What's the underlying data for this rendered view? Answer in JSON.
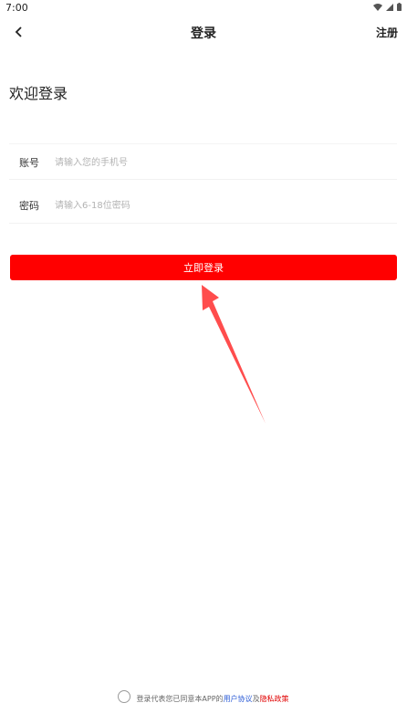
{
  "status_bar": {
    "time": "7:00"
  },
  "nav": {
    "title": "登录",
    "register_label": "注册"
  },
  "welcome": "欢迎登录",
  "form": {
    "account_label": "账号",
    "account_placeholder": "请输入您的手机号",
    "password_label": "密码",
    "password_placeholder": "请输入6-18位密码",
    "login_label": "立即登录"
  },
  "agreement": {
    "prefix": "登录代表您已同意本APP的",
    "user_agreement": "用户协议",
    "connector": "及",
    "privacy_policy": "隐私政策"
  },
  "colors": {
    "brand_red": "#ff0000",
    "arrow_red": "#ff4444",
    "user_link": "#2b5bd6",
    "privacy_link": "#e00000"
  }
}
